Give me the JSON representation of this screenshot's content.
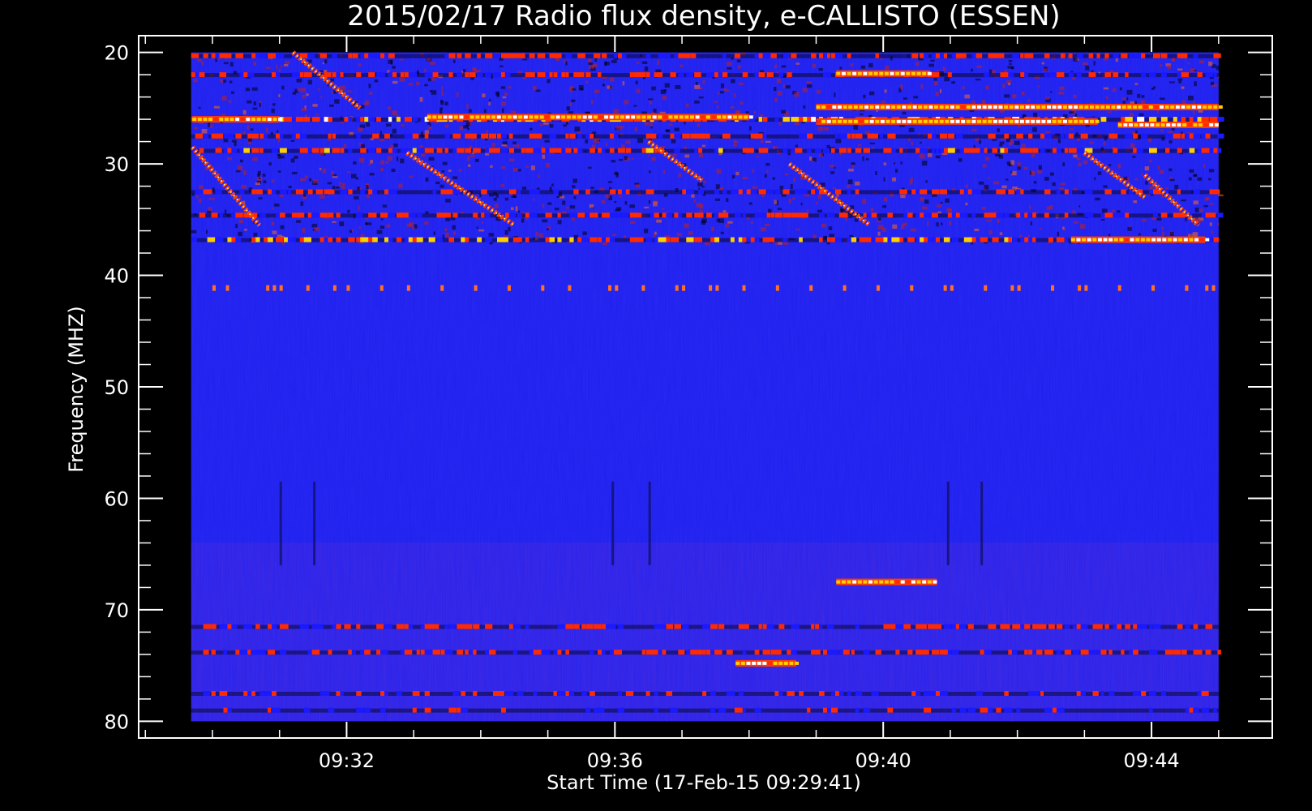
{
  "chart_data": {
    "type": "heatmap",
    "title": "2015/02/17  Radio flux density, e-CALLISTO (ESSEN)",
    "xlabel": "Start Time (17-Feb-15 09:29:41)",
    "ylabel": "Frequency (MHZ)",
    "x_ticks": [
      "09:32",
      "09:36",
      "09:40",
      "09:44"
    ],
    "x_tick_minutes": [
      32,
      36,
      40,
      44
    ],
    "y_ticks": [
      20,
      30,
      40,
      50,
      60,
      70,
      80
    ],
    "xlim_minutes": [
      29.683,
      45.0
    ],
    "axis_xlim_minutes": [
      28.9,
      45.8
    ],
    "ylim_mhz": [
      20,
      80
    ],
    "axis_ylim_mhz": [
      18.5,
      81.5
    ],
    "y_inverted": true,
    "colormap": [
      "#000000",
      "#1a1aff",
      "#ff2a00",
      "#ffd000",
      "#ffffff"
    ],
    "background_color": "#2020f0",
    "persistent_bands_mhz": [
      {
        "freq": 20.3,
        "intensity": 0.6
      },
      {
        "freq": 22.0,
        "intensity": 0.55
      },
      {
        "freq": 26.0,
        "intensity": 0.9
      },
      {
        "freq": 27.5,
        "intensity": 0.5
      },
      {
        "freq": 28.8,
        "intensity": 0.65
      },
      {
        "freq": 32.5,
        "intensity": 0.55
      },
      {
        "freq": 34.6,
        "intensity": 0.6
      },
      {
        "freq": 36.8,
        "intensity": 0.8
      },
      {
        "freq": 71.5,
        "intensity": 0.6
      },
      {
        "freq": 73.8,
        "intensity": 0.6
      },
      {
        "freq": 77.5,
        "intensity": 0.35
      },
      {
        "freq": 79.0,
        "intensity": 0.3
      }
    ],
    "strong_segments": [
      {
        "t_start": 29.7,
        "t_end": 31.0,
        "freq": 26.0
      },
      {
        "t_start": 33.2,
        "t_end": 38.0,
        "freq": 25.8
      },
      {
        "t_start": 39.0,
        "t_end": 43.2,
        "freq": 26.2
      },
      {
        "t_start": 39.0,
        "t_end": 45.0,
        "freq": 24.9
      },
      {
        "t_start": 43.5,
        "t_end": 45.0,
        "freq": 26.5
      },
      {
        "t_start": 39.3,
        "t_end": 40.7,
        "freq": 21.9
      },
      {
        "t_start": 42.8,
        "t_end": 44.8,
        "freq": 36.8
      },
      {
        "t_start": 37.8,
        "t_end": 38.7,
        "freq": 74.8
      },
      {
        "t_start": 39.3,
        "t_end": 40.8,
        "freq": 67.5
      }
    ],
    "drifting_bursts": [
      {
        "t_start": 29.7,
        "f_start": 28.5,
        "t_end": 30.7,
        "f_end": 35.5
      },
      {
        "t_start": 32.9,
        "f_start": 29.0,
        "t_end": 34.5,
        "f_end": 35.5
      },
      {
        "t_start": 36.5,
        "f_start": 28.0,
        "t_end": 37.3,
        "f_end": 31.5
      },
      {
        "t_start": 38.6,
        "f_start": 30.0,
        "t_end": 39.8,
        "f_end": 35.5
      },
      {
        "t_start": 43.0,
        "f_start": 29.0,
        "t_end": 43.9,
        "f_end": 33.0
      },
      {
        "t_start": 43.9,
        "f_start": 31.0,
        "t_end": 44.7,
        "f_end": 35.5
      },
      {
        "t_start": 31.2,
        "f_start": 20.0,
        "t_end": 32.2,
        "f_end": 25.0
      }
    ],
    "periodic_marker_freq_mhz": 41.1,
    "periodic_marker_times_minutes": [
      30.0,
      30.2,
      30.8,
      30.9,
      31.0,
      31.4,
      31.8,
      32.0,
      32.5,
      32.9,
      33.4,
      33.9,
      34.4,
      34.9,
      35.3,
      35.9,
      36.0,
      36.4,
      36.9,
      37.0,
      37.4,
      37.5,
      37.9,
      38.4,
      38.9,
      39.4,
      39.9,
      40.4,
      40.9,
      41.0,
      41.5,
      41.9,
      42.0,
      42.5,
      42.9,
      43.0,
      43.5,
      44.0,
      44.5,
      44.8,
      44.9
    ]
  }
}
